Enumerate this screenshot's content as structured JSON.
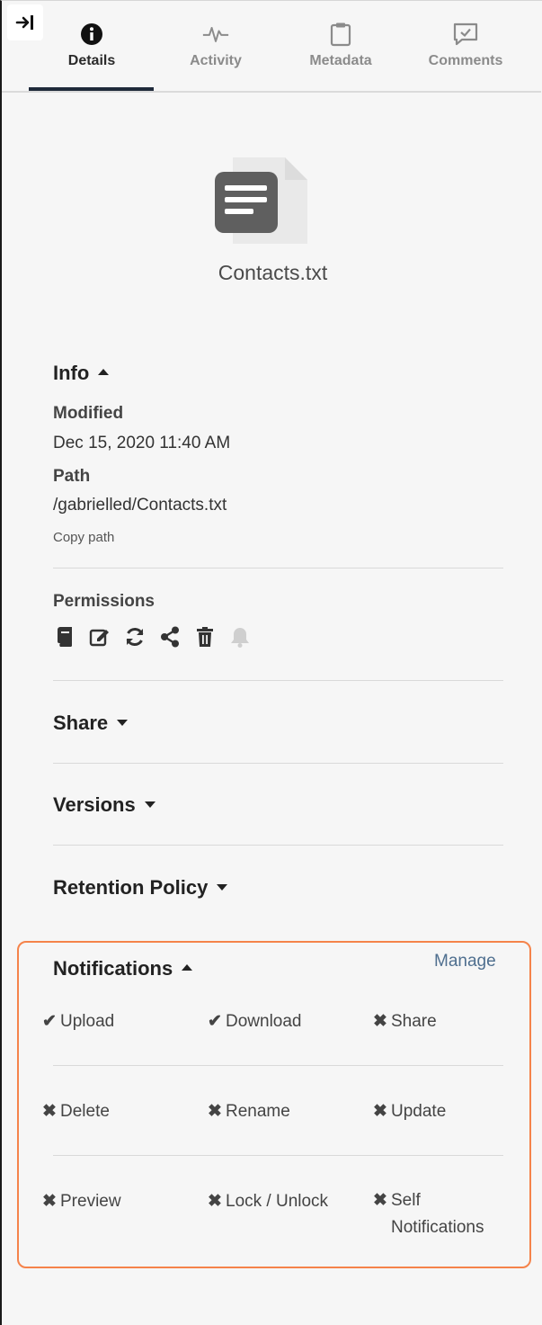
{
  "tabs": [
    {
      "label": "Details",
      "icon": "info-icon",
      "active": true
    },
    {
      "label": "Activity",
      "icon": "activity-icon"
    },
    {
      "label": "Metadata",
      "icon": "clipboard-icon"
    },
    {
      "label": "Comments",
      "icon": "comment-check-icon"
    }
  ],
  "file": {
    "name": "Contacts.txt",
    "icon": "text-file-icon"
  },
  "info": {
    "title": "Info",
    "modified_label": "Modified",
    "modified_value": "Dec 15, 2020 11:40 AM",
    "path_label": "Path",
    "path_value": "/gabrielled/Contacts.txt",
    "copy_path": "Copy path"
  },
  "permissions": {
    "label": "Permissions",
    "icons": [
      "book-icon",
      "edit-icon",
      "sync-icon",
      "share-icon",
      "trash-icon",
      "bell-icon"
    ]
  },
  "sections": {
    "share": "Share",
    "versions": "Versions",
    "retention": "Retention Policy"
  },
  "notifications": {
    "title": "Notifications",
    "manage": "Manage",
    "items": [
      {
        "label": "Upload",
        "enabled": true
      },
      {
        "label": "Download",
        "enabled": true
      },
      {
        "label": "Share",
        "enabled": false
      },
      {
        "label": "Delete",
        "enabled": false
      },
      {
        "label": "Rename",
        "enabled": false
      },
      {
        "label": "Update",
        "enabled": false
      },
      {
        "label": "Preview",
        "enabled": false
      },
      {
        "label": "Lock / Unlock",
        "enabled": false
      },
      {
        "label": "Self",
        "enabled": false
      },
      {
        "label": "Notifications",
        "enabled": false
      }
    ]
  },
  "colors": {
    "accent": "#f5834a",
    "tab_active": "#1f2a3a",
    "link": "#4f6f8f"
  }
}
